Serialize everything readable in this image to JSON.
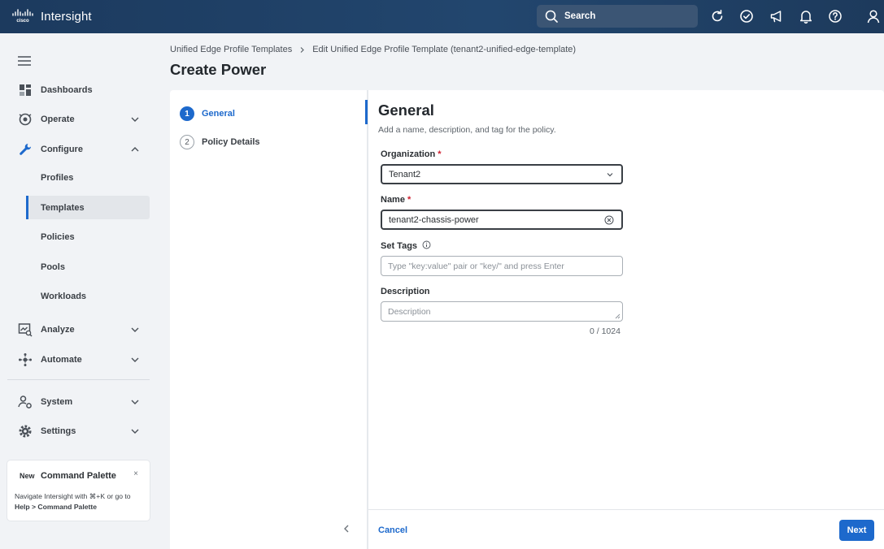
{
  "app": {
    "brand": "Intersight",
    "logo_text": "cisco"
  },
  "topbar": {
    "search_label": "Search",
    "icons": [
      "refresh-icon",
      "check-circle-icon",
      "megaphone-icon",
      "bell-icon",
      "help-icon",
      "user-icon"
    ]
  },
  "sidebar": {
    "items": [
      {
        "label": "Dashboards",
        "icon": "dashboard-icon"
      },
      {
        "label": "Operate",
        "icon": "operate-icon",
        "expanded": false
      },
      {
        "label": "Configure",
        "icon": "wrench-icon",
        "expanded": true
      },
      {
        "label": "Analyze",
        "icon": "analyze-icon",
        "expanded": false
      },
      {
        "label": "Automate",
        "icon": "automate-icon",
        "expanded": false
      },
      {
        "label": "System",
        "icon": "system-icon",
        "expanded": false
      },
      {
        "label": "Settings",
        "icon": "gear-icon",
        "expanded": false
      }
    ],
    "configure_children": [
      "Profiles",
      "Templates",
      "Policies",
      "Pools",
      "Workloads"
    ],
    "active_child": "Templates"
  },
  "command_palette": {
    "badge": "New",
    "title": "Command Palette",
    "close": "×",
    "desc_prefix": "Navigate Intersight with ⌘+K or go to ",
    "desc_bold": "Help > Command Palette"
  },
  "breadcrumb": {
    "items": [
      "Unified Edge Profile Templates",
      "Edit Unified Edge Profile Template (tenant2-unified-edge-template)"
    ]
  },
  "page_title": "Create Power",
  "steps": [
    {
      "num": "1",
      "label": "General",
      "active": true
    },
    {
      "num": "2",
      "label": "Policy Details",
      "active": false
    }
  ],
  "form": {
    "title": "General",
    "subtitle": "Add a name, description, and tag for the policy.",
    "organization": {
      "label": "Organization",
      "required": "*",
      "value": "Tenant2"
    },
    "name": {
      "label": "Name",
      "required": "*",
      "value": "tenant2-chassis-power"
    },
    "tags": {
      "label": "Set Tags",
      "placeholder": "Type \"key:value\" pair or \"key/\" and press Enter"
    },
    "description": {
      "label": "Description",
      "placeholder": "Description",
      "counter": "0 / 1024"
    }
  },
  "footer": {
    "cancel": "Cancel",
    "next": "Next"
  },
  "colors": {
    "accent": "#1d69cc",
    "topbar": "#1f3f63",
    "required": "#cf2030"
  }
}
